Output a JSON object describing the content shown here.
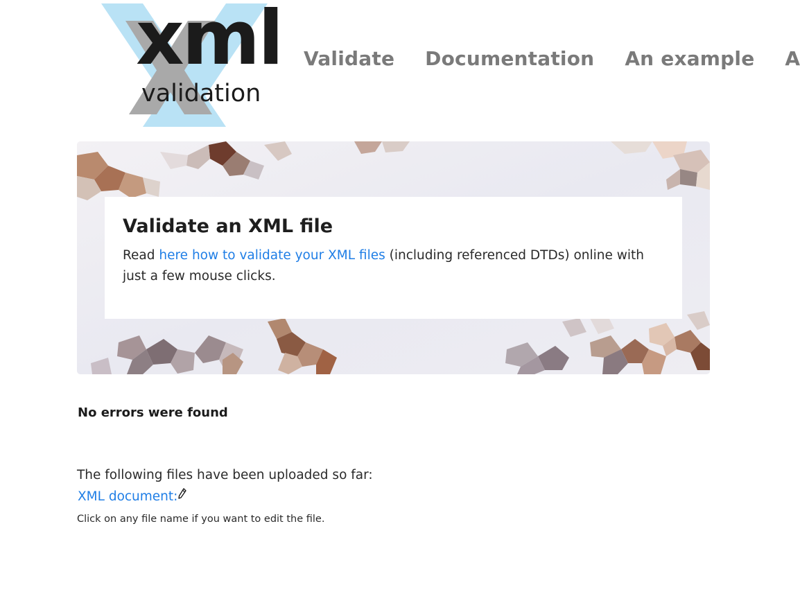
{
  "logo": {
    "main_text": "xml",
    "sub_text": "validation",
    "accent_color": "#b9e2f5"
  },
  "nav": {
    "items": [
      {
        "label": "Validate"
      },
      {
        "label": "Documentation"
      },
      {
        "label": "An example"
      },
      {
        "label": "Abou"
      }
    ],
    "color": "#7a7a7a"
  },
  "hero": {
    "title": "Validate an XML file",
    "text_before": "Read ",
    "link_text": "here how to validate your XML files",
    "text_after": " (including referenced DTDs) online with just a few mouse clicks."
  },
  "result": {
    "message": "No errors were found"
  },
  "files": {
    "intro": "The following files have been uploaded so far:",
    "items": [
      {
        "label": "XML document:",
        "icon": "pencil-icon"
      }
    ],
    "hint": "Click on any file name if you want to edit the file."
  },
  "colors": {
    "link": "#1f7ee6",
    "text": "#2a2a2a"
  }
}
